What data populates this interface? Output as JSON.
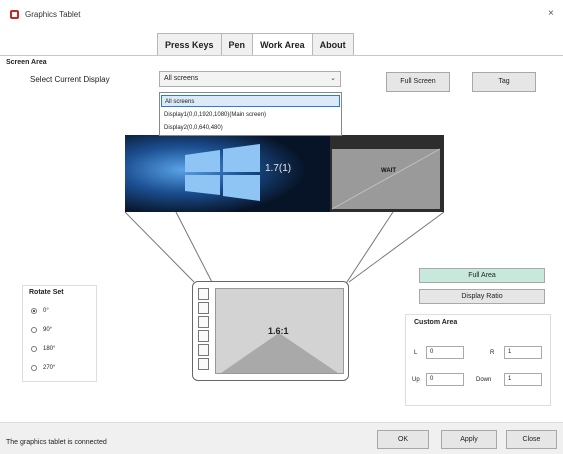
{
  "window": {
    "title": "Graphics Tablet",
    "close": "×"
  },
  "tabs": [
    {
      "label": "Press Keys"
    },
    {
      "label": "Pen"
    },
    {
      "label": "Work Area"
    },
    {
      "label": "About"
    }
  ],
  "screen_area": {
    "heading": "Screen Area",
    "select_label": "Select Current Display",
    "select_value": "All screens",
    "dropdown_options": [
      "All screens",
      "Display1(0,0,1920,1080)(Main screen)",
      "Display2(0,0,640,480)"
    ],
    "full_screen_btn": "Full Screen",
    "tag_btn": "Tag",
    "screen_ratio": "1.7(1)",
    "second_screen_text": "WAIT"
  },
  "tablet": {
    "ratio": "1.6:1",
    "key_count": 6
  },
  "rotate": {
    "heading": "Rotate Set",
    "options": [
      "0°",
      "90°",
      "180°",
      "270°"
    ],
    "selected": "0°"
  },
  "area_buttons": {
    "full_area": "Full Area",
    "display_ratio": "Display Ratio"
  },
  "custom_area": {
    "heading": "Custom Area",
    "l_label": "L",
    "l_value": "0",
    "r_label": "R",
    "r_value": "1",
    "up_label": "Up",
    "up_value": "0",
    "down_label": "Down",
    "down_value": "1"
  },
  "status": {
    "message": "The graphics tablet is connected"
  },
  "footer": {
    "ok": "OK",
    "apply": "Apply",
    "close": "Close"
  },
  "colors": {
    "accent": "#2a7bd1",
    "full_area_bg": "#c6e9dc",
    "desktop": "#0b1c33"
  }
}
